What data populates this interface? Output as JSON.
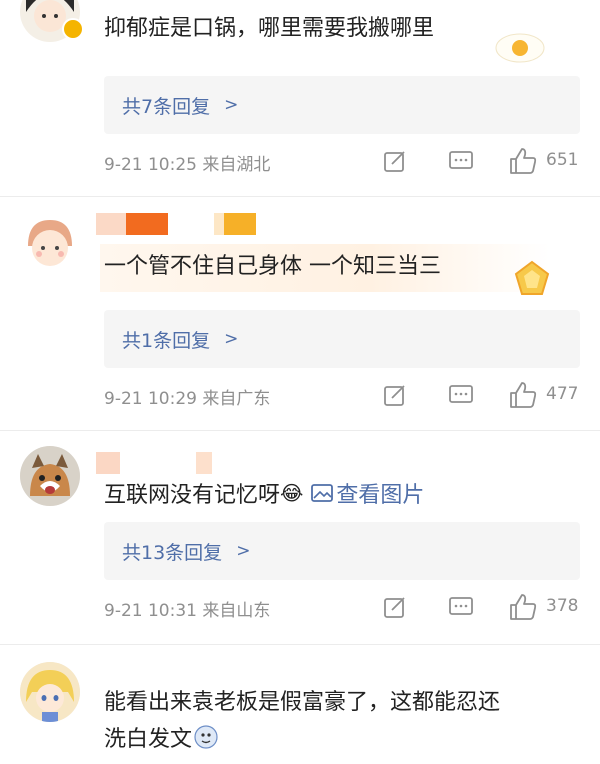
{
  "comments": [
    {
      "text": "抑郁症是口锅，哪里需要我搬哪里",
      "reply": "共7条回复",
      "time": "9-21 10:25 来自湖北",
      "likes": "651"
    },
    {
      "text": "一个管不住自己身体  一个知三当三",
      "reply": "共1条回复",
      "time": "9-21 10:29 来自广东",
      "likes": "477"
    },
    {
      "text": "互联网没有记忆呀",
      "emoji": "😂",
      "image_link": "查看图片",
      "reply": "共13条回复",
      "time": "9-21 10:31 来自山东",
      "likes": "378"
    },
    {
      "text_line1": "能看出来袁老板是假富豪了，这都能忍还",
      "text_line2": "洗白发文"
    }
  ],
  "reply_chevron": ">",
  "colors": {
    "link": "#4f6ea8",
    "meta": "#8f8f8f",
    "reply_bg": "#f5f5f5"
  },
  "icons": [
    "edit-icon",
    "comment-icon",
    "like-icon",
    "image-icon",
    "chevron-right-icon"
  ]
}
